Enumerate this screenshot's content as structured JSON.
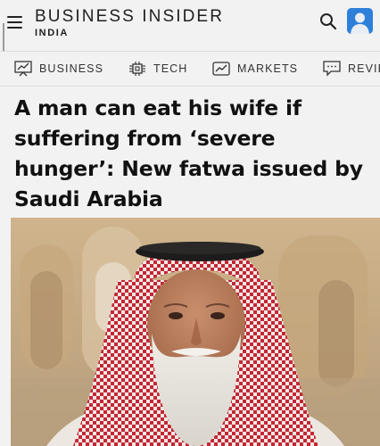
{
  "header": {
    "brand_name": "BUSINESS INSIDER",
    "edition": "INDIA",
    "menu_icon": "hamburger-menu-icon",
    "search_icon": "search-icon",
    "avatar_icon": "user-avatar-icon"
  },
  "nav": {
    "items": [
      {
        "label": "BUSINESS",
        "icon": "chart-board-icon"
      },
      {
        "label": "TECH",
        "icon": "chip-icon"
      },
      {
        "label": "MARKETS",
        "icon": "market-graph-icon"
      },
      {
        "label": "REVIE",
        "icon": "review-chat-icon"
      }
    ]
  },
  "article": {
    "headline": "A man can eat his wife if suffering from ‘severe hunger’: New fatwa issued by Saudi Arabia"
  },
  "colors": {
    "avatar_bg": "#2e7fd9",
    "headscarf_red": "#c32735",
    "page_bg": "#f2f2f2"
  }
}
